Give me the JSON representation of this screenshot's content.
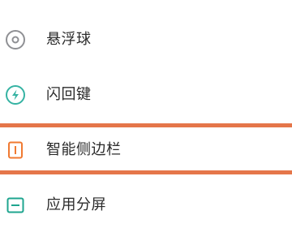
{
  "menu": {
    "items": [
      {
        "label": "悬浮球",
        "icon": "floating-ball-icon",
        "color": "#8f9094"
      },
      {
        "label": "闪回键",
        "icon": "flashback-key-icon",
        "color": "#36b3a3"
      },
      {
        "label": "智能侧边栏",
        "icon": "smart-sidebar-icon",
        "color": "#f07a32"
      },
      {
        "label": "应用分屏",
        "icon": "split-screen-icon",
        "color": "#1fa58f"
      }
    ],
    "selected_index": 2
  },
  "colors": {
    "highlight": "#e5764a",
    "text": "#2b2b2b"
  }
}
